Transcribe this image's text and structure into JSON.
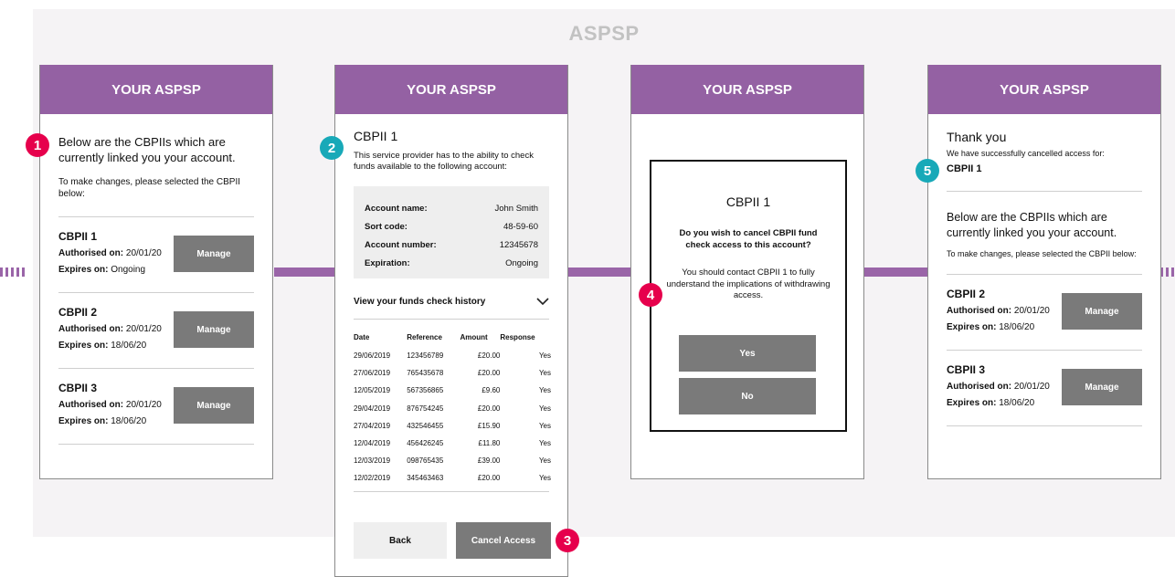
{
  "section_title": "ASPSP",
  "header_title": "YOUR ASPSP",
  "screen1": {
    "intro": "Below are the CBPIIs which are currently linked you your account.",
    "instruction": "To make changes, please selected the CBPII below:",
    "authorised_label": "Authorised on:",
    "expires_label": "Expires on:",
    "manage_label": "Manage",
    "items": [
      {
        "name": "CBPII 1",
        "authorised": "20/01/20",
        "expires": "Ongoing"
      },
      {
        "name": "CBPII 2",
        "authorised": "20/01/20",
        "expires": "18/06/20"
      },
      {
        "name": "CBPII 3",
        "authorised": "20/01/20",
        "expires": "18/06/20"
      }
    ]
  },
  "screen2": {
    "title": "CBPII 1",
    "description": "This service provider has to the ability to check funds available to the following account:",
    "details": [
      {
        "label": "Account name:",
        "value": "John Smith"
      },
      {
        "label": "Sort code:",
        "value": "48-59-60"
      },
      {
        "label": "Account number:",
        "value": "12345678"
      },
      {
        "label": "Expiration:",
        "value": "Ongoing"
      }
    ],
    "history_toggle": "View your funds check history",
    "columns": [
      "Date",
      "Reference",
      "Amount",
      "Response"
    ],
    "rows": [
      [
        "29/06/2019",
        "123456789",
        "£20.00",
        "Yes"
      ],
      [
        "27/06/2019",
        "765435678",
        "£20.00",
        "Yes"
      ],
      [
        "12/05/2019",
        "567356865",
        "£9.60",
        "Yes"
      ],
      [
        "29/04/2019",
        "876754245",
        "£20.00",
        "Yes"
      ],
      [
        "27/04/2019",
        "432546455",
        "£15.90",
        "Yes"
      ],
      [
        "12/04/2019",
        "456426245",
        "£11.80",
        "Yes"
      ],
      [
        "12/03/2019",
        "098765435",
        "£39.00",
        "Yes"
      ],
      [
        "12/02/2019",
        "345463463",
        "£20.00",
        "Yes"
      ]
    ],
    "back_label": "Back",
    "cancel_label": "Cancel Access"
  },
  "screen3": {
    "title": "CBPII 1",
    "question": "Do you wish to cancel CBPII fund check access to this account?",
    "advice": "You should contact CBPII 1 to fully understand the implications of withdrawing access.",
    "yes_label": "Yes",
    "no_label": "No"
  },
  "screen4": {
    "thanks": "Thank you",
    "success": "We have successfully cancelled access for:",
    "cancelled_name": "CBPII 1",
    "intro": "Below are the CBPIIs which are currently linked you your account.",
    "instruction": "To make changes, please selected the CBPII below:",
    "items": [
      {
        "name": "CBPII 2",
        "authorised": "20/01/20",
        "expires": "18/06/20"
      },
      {
        "name": "CBPII 3",
        "authorised": "20/01/20",
        "expires": "18/06/20"
      }
    ]
  },
  "badges": [
    "1",
    "2",
    "3",
    "4",
    "5"
  ],
  "colors": {
    "header": "#9461a3",
    "connector": "#9a65a8",
    "badge_pink": "#e6004c",
    "badge_teal": "#18a9b8",
    "button_grey": "#7a7a7a"
  },
  "icons": {
    "chevron": "chevron-down-icon"
  }
}
